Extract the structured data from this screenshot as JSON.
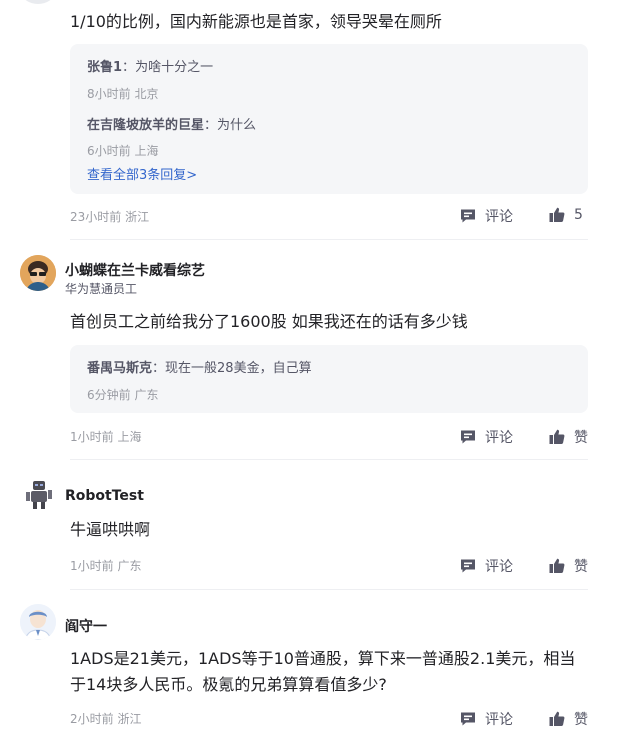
{
  "comments": [
    {
      "text": "1/10的比例，国内新能源也是首家，领导哭晕在厕所",
      "replies": [
        {
          "name": "张鲁1",
          "sep": "：",
          "text": "为啥十分之一",
          "meta": "8小时前 北京"
        },
        {
          "name": "在吉隆坡放羊的巨星",
          "sep": "：",
          "text": "为什么",
          "meta": "6小时前 上海"
        }
      ],
      "more_replies": "查看全部3条回复>",
      "time_location": "23小时前 浙江",
      "comment_label": "评论",
      "like_label": "5"
    },
    {
      "user": "小蝴蝶在兰卡威看综艺",
      "tag": "华为慧通员工",
      "text": "首创员工之前给我分了1600股 如果我还在的话有多少钱",
      "replies": [
        {
          "name": "番禺马斯克",
          "sep": "：",
          "text": "现在一般28美金，自己算",
          "meta": "6分钟前 广东"
        }
      ],
      "time_location": "1小时前 上海",
      "comment_label": "评论",
      "like_label": "赞"
    },
    {
      "user": "RobotTest",
      "text": "牛逼哄哄啊",
      "time_location": "1小时前 广东",
      "comment_label": "评论",
      "like_label": "赞"
    },
    {
      "user": "阎守一",
      "text": "1ADS是21美元，1ADS等于10普通股，算下来一普通股2.1美元，相当于14块多人民币。极氪的兄弟算算看值多少?",
      "time_location": "2小时前 浙江",
      "comment_label": "评论",
      "like_label": "赞"
    }
  ],
  "colors": {
    "accent_link": "#3366cc",
    "meta_gray": "#9a9ca3",
    "reply_bg": "#f5f6f8"
  },
  "icons": {
    "comment": "comment-bubble-icon",
    "like": "thumbs-up-icon"
  }
}
